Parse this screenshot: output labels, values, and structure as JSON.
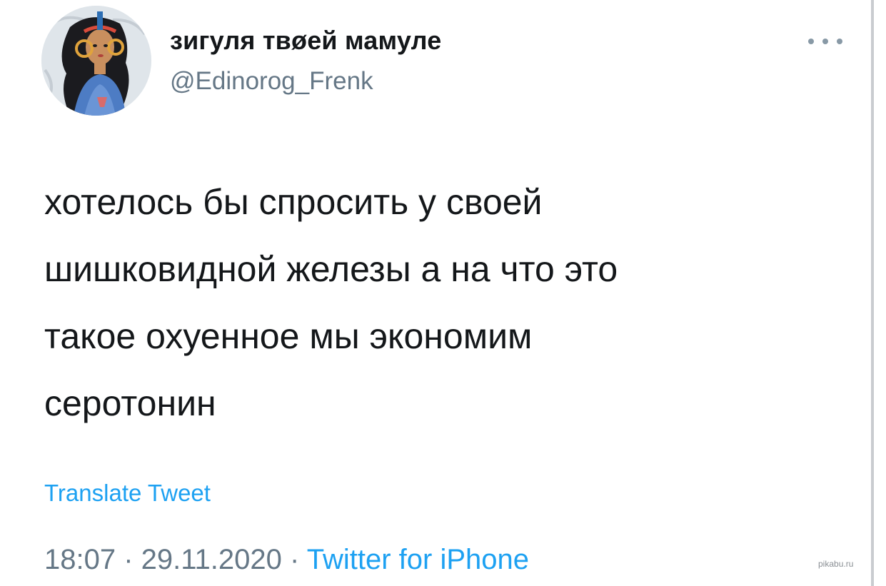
{
  "user": {
    "display_name": "зигуля твøей мамуле",
    "handle": "@Edinorog_Frenk",
    "avatar_icon": "illustrated-woman-avatar",
    "badge_icon": "crescent-moon-icon"
  },
  "menu": {
    "more_icon": "more-dots-icon"
  },
  "tweet": {
    "lines": [
      "хотелось бы спросить у своей",
      "шишковидной железы а на что это",
      "такое охуенное мы экономим",
      "серотонин"
    ],
    "translate_label": "Translate Tweet",
    "time": "18:07",
    "separator_1": "·",
    "date": "29.11.2020",
    "separator_2": "·",
    "source": "Twitter for iPhone"
  },
  "watermark": "pikabu.ru",
  "colors": {
    "text": "#14171a",
    "secondary": "#657786",
    "link": "#1da1f2",
    "moon": "#f5b800"
  }
}
